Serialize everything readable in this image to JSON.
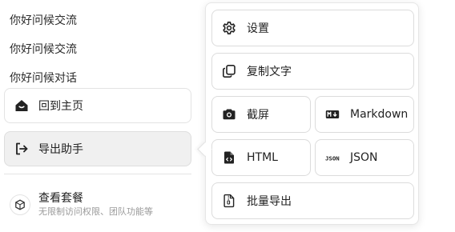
{
  "conversations": [
    "你好问候交流",
    "你好问候交流",
    "你好问候对话"
  ],
  "sidebar": {
    "home_label": "回到主页",
    "export_label": "导出助手"
  },
  "plan": {
    "title": "查看套餐",
    "subtitle": "无限制访问权限、团队功能等"
  },
  "export_menu": {
    "settings_label": "设置",
    "copy_text_label": "复制文字",
    "screenshot_label": "截屏",
    "markdown_label": "Markdown",
    "html_label": "HTML",
    "json_label": "JSON",
    "batch_export_label": "批量导出"
  },
  "icons": {
    "home": "house-icon",
    "export": "export-arrow-icon",
    "plan": "cube-icon",
    "settings": "gear-icon",
    "copy": "copy-icon",
    "screenshot": "camera-icon",
    "markdown": "markdown-icon",
    "html": "code-file-icon",
    "json": "json-icon",
    "batch": "file-zip-icon"
  }
}
